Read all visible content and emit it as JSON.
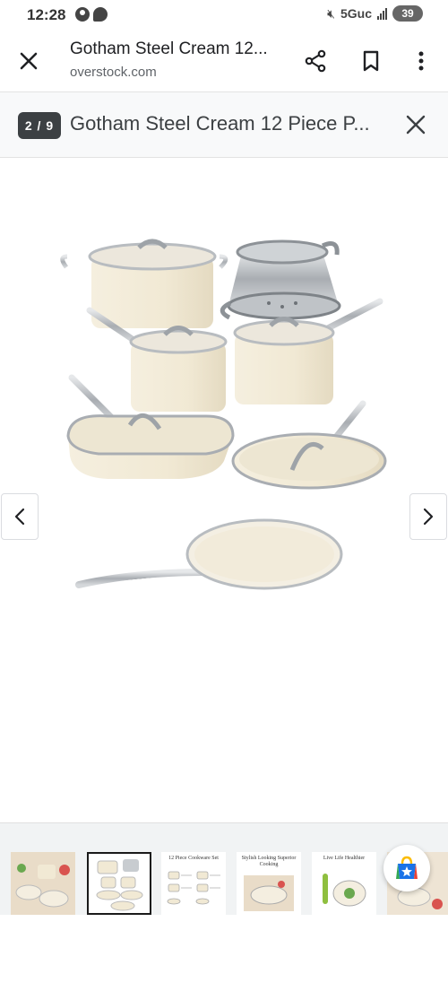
{
  "status_bar": {
    "time": "12:28",
    "network": "5Guc",
    "battery": "39"
  },
  "header": {
    "title": "Gotham Steel Cream 12...",
    "url": "overstock.com"
  },
  "viewer": {
    "counter": "2 / 9",
    "title": "Gotham Steel Cream 12 Piece P..."
  },
  "thumbnails": [
    {
      "text": ""
    },
    {
      "text": ""
    },
    {
      "text": "12 Piece Cookware Set"
    },
    {
      "text": "Stylish Looking Superior Cooking"
    },
    {
      "text": "Live Life Healthier"
    },
    {
      "text": ""
    }
  ],
  "colors": {
    "cream": "#f3ecd9",
    "steel": "#b8bcc0",
    "badge": "#3c4043"
  },
  "icons": {
    "close": "close-icon",
    "share": "share-icon",
    "bookmark": "bookmark-icon",
    "menu": "more-vert-icon",
    "prev": "chevron-left-icon",
    "next": "chevron-right-icon",
    "fab": "shopping-bag-star-icon"
  }
}
